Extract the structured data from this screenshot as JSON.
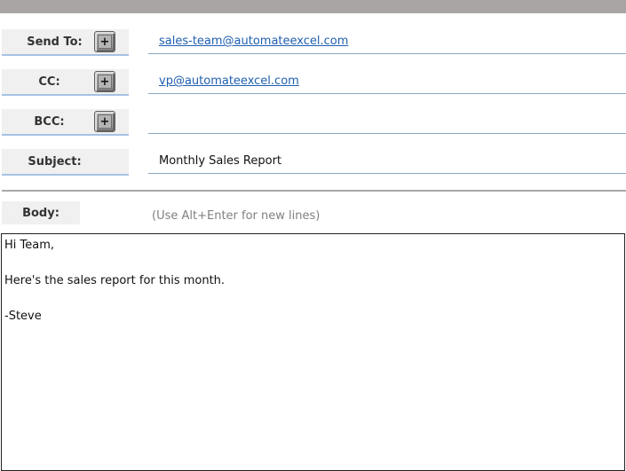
{
  "email_form": {
    "send_to": {
      "label": "Send To:",
      "value": "sales-team@automateexcel.com",
      "add_button": "+"
    },
    "cc": {
      "label": "CC:",
      "value": "vp@automateexcel.com",
      "add_button": "+"
    },
    "bcc": {
      "label": "BCC:",
      "value": "",
      "add_button": "+"
    },
    "subject": {
      "label": "Subject:",
      "value": "Monthly Sales Report"
    },
    "body": {
      "label": "Body:",
      "hint": "(Use Alt+Enter for new lines)",
      "lines": [
        "Hi Team,",
        "",
        "Here's the sales report for this month.",
        "",
        "-Steve"
      ]
    }
  },
  "colors": {
    "top_bar": "#a9a5a5",
    "label_bg": "#f0f0f0",
    "link": "#1f5fb0",
    "field_underline": "#8ca6c0",
    "hint_text": "#808080"
  }
}
